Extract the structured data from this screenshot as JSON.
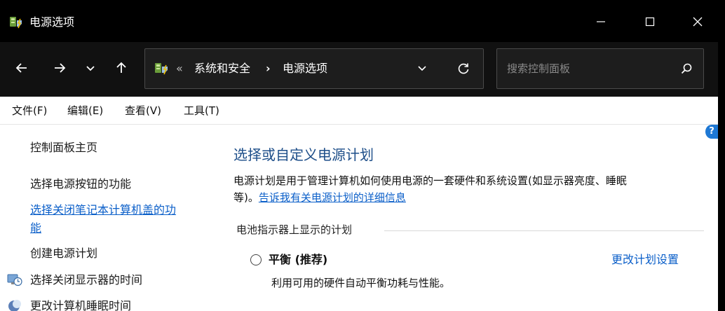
{
  "window": {
    "title": "电源选项",
    "app_icon": "power-options-icon",
    "controls": [
      "minimize-icon",
      "maximize-icon",
      "close-icon"
    ]
  },
  "nav": {
    "buttons": [
      "back-arrow-icon",
      "forward-arrow-icon",
      "recent-dropdown-icon",
      "up-arrow-icon"
    ]
  },
  "address": {
    "icon": "power-options-icon",
    "overflow": "«",
    "crumbs": [
      "系统和安全",
      "电源选项"
    ],
    "separator": "›"
  },
  "search": {
    "placeholder": "搜索控制面板"
  },
  "menu": {
    "items": [
      "文件(F)",
      "编辑(E)",
      "查看(V)",
      "工具(T)"
    ]
  },
  "sidebar": {
    "items": [
      {
        "label": "控制面板主页"
      },
      {
        "label": "选择电源按钮的功能"
      },
      {
        "label_line1": "选择关闭笔记本计算机盖的功",
        "label_line2": "能"
      },
      {
        "label": "创建电源计划"
      },
      {
        "label": "选择关闭显示器的时间",
        "icon": "display-schedule-icon"
      },
      {
        "label": "更改计算机睡眠时间",
        "icon": "sleep-moon-icon"
      }
    ]
  },
  "main": {
    "help": "?",
    "title": "选择或自定义电源计划",
    "description_line1": "电源计划是用于管理计算机如何使用电源的一套硬件和系统设置(如显示器亮度、睡眠",
    "description_line2": "等)。",
    "learn_more": "告诉我有关电源计划的详细信息",
    "group_label": "电池指示器上显示的计划",
    "plan": {
      "name": "平衡 (推荐)",
      "change_link": "更改计划设置",
      "description": "利用可用的硬件自动平衡功耗与性能。"
    }
  },
  "colors": {
    "link": "#0b5fc9",
    "title": "#1d4e89",
    "titlebar_bg": "#000000",
    "navbar_bg": "#111111"
  }
}
